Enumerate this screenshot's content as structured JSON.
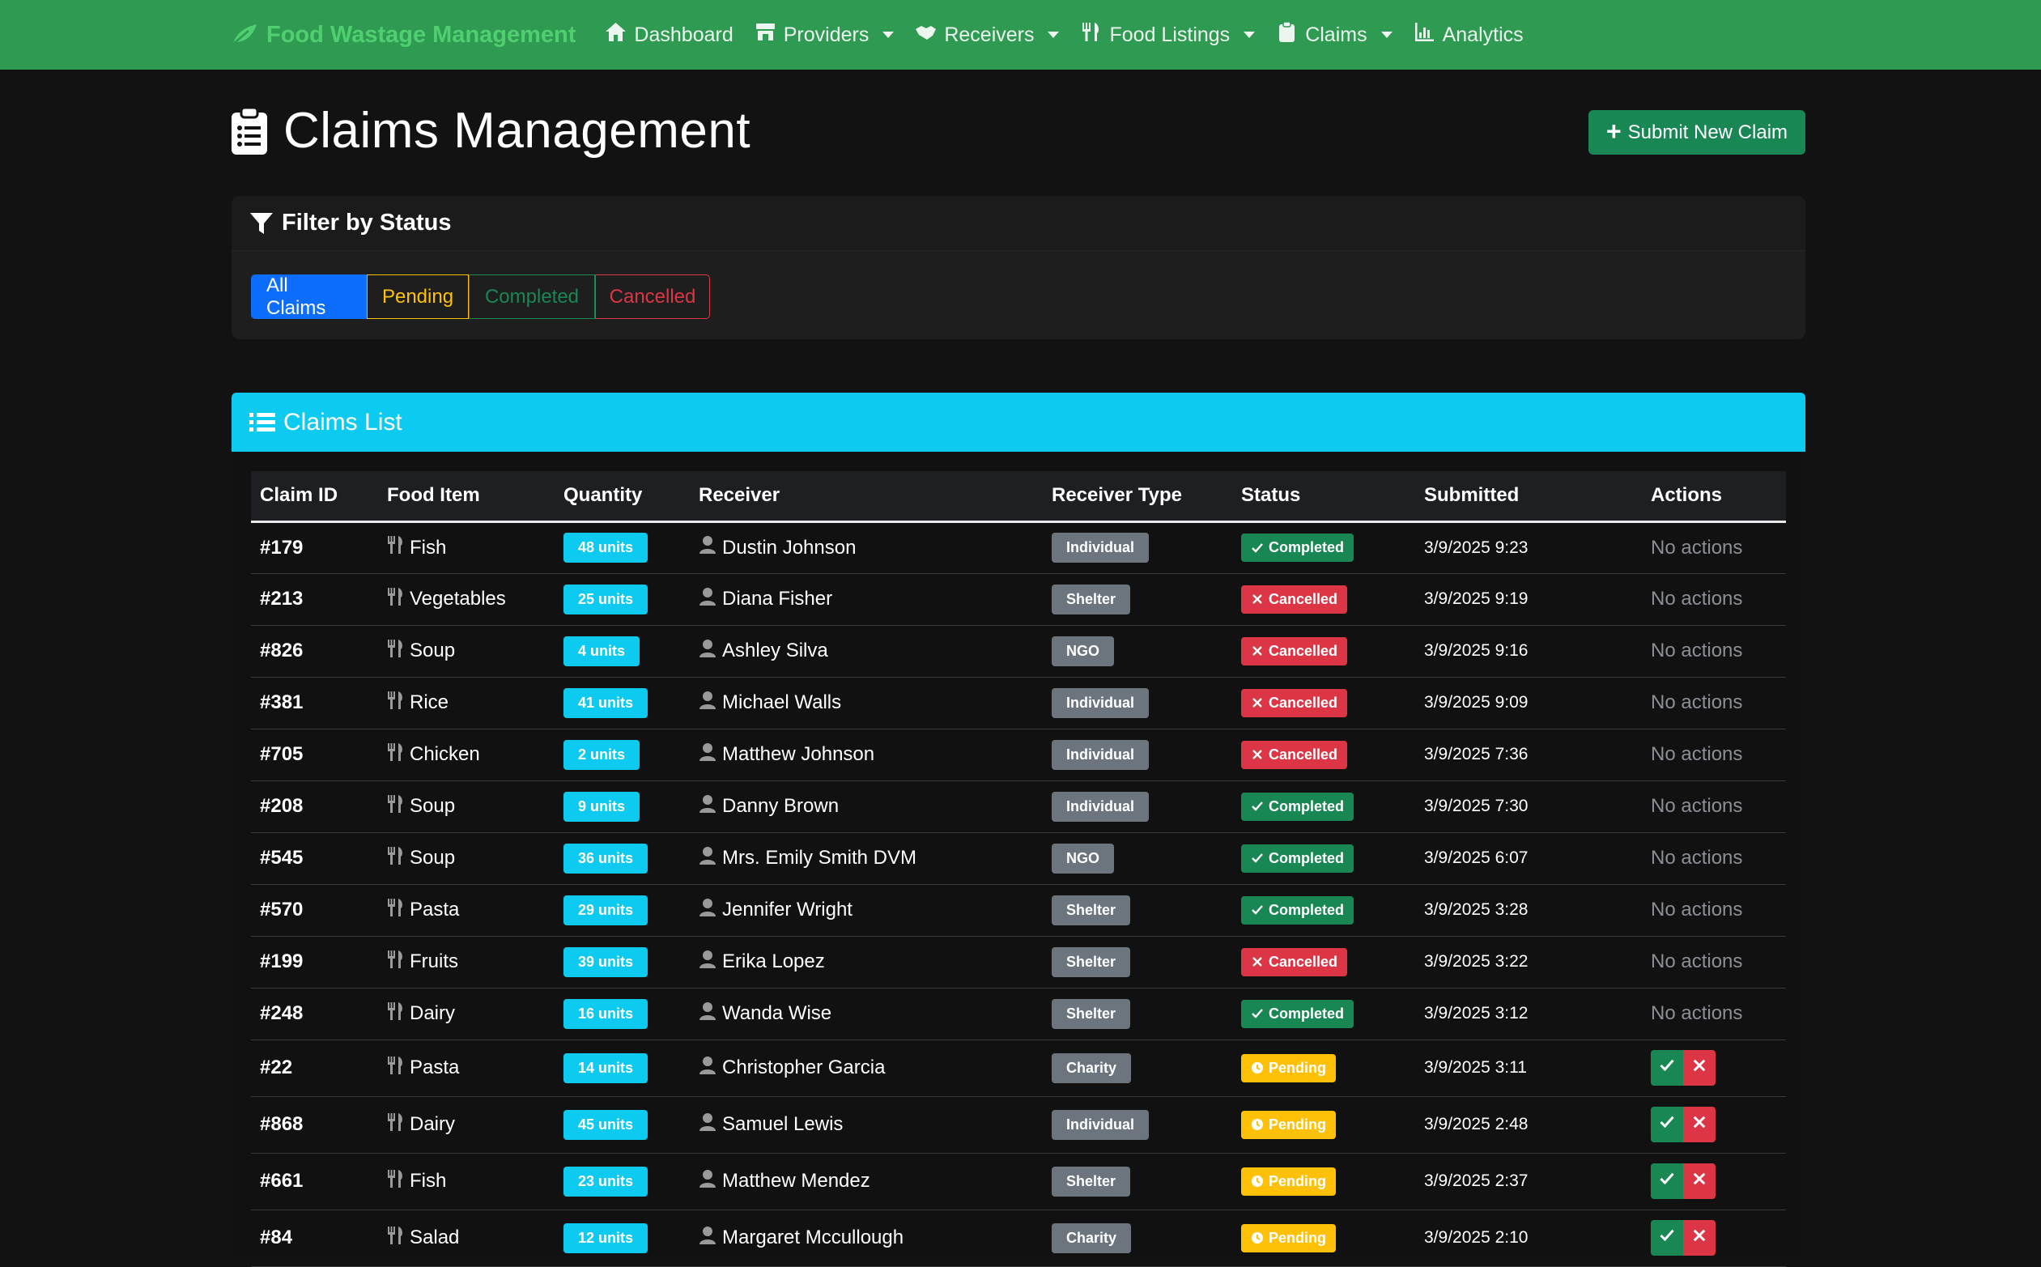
{
  "nav": {
    "brand": "Food Wastage Management",
    "items": [
      {
        "label": "Dashboard",
        "icon": "home-icon",
        "dropdown": false
      },
      {
        "label": "Providers",
        "icon": "store-icon",
        "dropdown": true
      },
      {
        "label": "Receivers",
        "icon": "handshake-icon",
        "dropdown": true
      },
      {
        "label": "Food Listings",
        "icon": "utensils-icon",
        "dropdown": true
      },
      {
        "label": "Claims",
        "icon": "clipboard-icon",
        "dropdown": true
      },
      {
        "label": "Analytics",
        "icon": "chart-icon",
        "dropdown": false
      }
    ]
  },
  "page": {
    "title": "Claims Management",
    "new_button": "Submit New Claim"
  },
  "filter": {
    "title": "Filter by Status",
    "options": [
      "All Claims",
      "Pending",
      "Completed",
      "Cancelled"
    ],
    "active": "All Claims"
  },
  "list": {
    "title": "Claims List",
    "columns": [
      "Claim ID",
      "Food Item",
      "Quantity",
      "Receiver",
      "Receiver Type",
      "Status",
      "Submitted",
      "Actions"
    ],
    "no_actions_label": "No actions",
    "rows": [
      {
        "id": "#179",
        "food": "Fish",
        "qty": "48 units",
        "receiver": "Dustin Johnson",
        "type": "Individual",
        "status": "Completed",
        "submitted": "3/9/2025 9:23"
      },
      {
        "id": "#213",
        "food": "Vegetables",
        "qty": "25 units",
        "receiver": "Diana Fisher",
        "type": "Shelter",
        "status": "Cancelled",
        "submitted": "3/9/2025 9:19"
      },
      {
        "id": "#826",
        "food": "Soup",
        "qty": "4 units",
        "receiver": "Ashley Silva",
        "type": "NGO",
        "status": "Cancelled",
        "submitted": "3/9/2025 9:16"
      },
      {
        "id": "#381",
        "food": "Rice",
        "qty": "41 units",
        "receiver": "Michael Walls",
        "type": "Individual",
        "status": "Cancelled",
        "submitted": "3/9/2025 9:09"
      },
      {
        "id": "#705",
        "food": "Chicken",
        "qty": "2 units",
        "receiver": "Matthew Johnson",
        "type": "Individual",
        "status": "Cancelled",
        "submitted": "3/9/2025 7:36"
      },
      {
        "id": "#208",
        "food": "Soup",
        "qty": "9 units",
        "receiver": "Danny Brown",
        "type": "Individual",
        "status": "Completed",
        "submitted": "3/9/2025 7:30"
      },
      {
        "id": "#545",
        "food": "Soup",
        "qty": "36 units",
        "receiver": "Mrs. Emily Smith DVM",
        "type": "NGO",
        "status": "Completed",
        "submitted": "3/9/2025 6:07"
      },
      {
        "id": "#570",
        "food": "Pasta",
        "qty": "29 units",
        "receiver": "Jennifer Wright",
        "type": "Shelter",
        "status": "Completed",
        "submitted": "3/9/2025 3:28"
      },
      {
        "id": "#199",
        "food": "Fruits",
        "qty": "39 units",
        "receiver": "Erika Lopez",
        "type": "Shelter",
        "status": "Cancelled",
        "submitted": "3/9/2025 3:22"
      },
      {
        "id": "#248",
        "food": "Dairy",
        "qty": "16 units",
        "receiver": "Wanda Wise",
        "type": "Shelter",
        "status": "Completed",
        "submitted": "3/9/2025 3:12"
      },
      {
        "id": "#22",
        "food": "Pasta",
        "qty": "14 units",
        "receiver": "Christopher Garcia",
        "type": "Charity",
        "status": "Pending",
        "submitted": "3/9/2025 3:11"
      },
      {
        "id": "#868",
        "food": "Dairy",
        "qty": "45 units",
        "receiver": "Samuel Lewis",
        "type": "Individual",
        "status": "Pending",
        "submitted": "3/9/2025 2:48"
      },
      {
        "id": "#661",
        "food": "Fish",
        "qty": "23 units",
        "receiver": "Matthew Mendez",
        "type": "Shelter",
        "status": "Pending",
        "submitted": "3/9/2025 2:37"
      },
      {
        "id": "#84",
        "food": "Salad",
        "qty": "12 units",
        "receiver": "Margaret Mccullough",
        "type": "Charity",
        "status": "Pending",
        "submitted": "3/9/2025 2:10"
      }
    ]
  },
  "colors": {
    "navbar": "#2f9a52",
    "brand": "#4fcf6f",
    "primary": "#0d6efd",
    "info": "#0dcaf0",
    "success": "#198754",
    "danger": "#dc3545",
    "warning": "#ffc107",
    "secondary": "#6c757d"
  }
}
